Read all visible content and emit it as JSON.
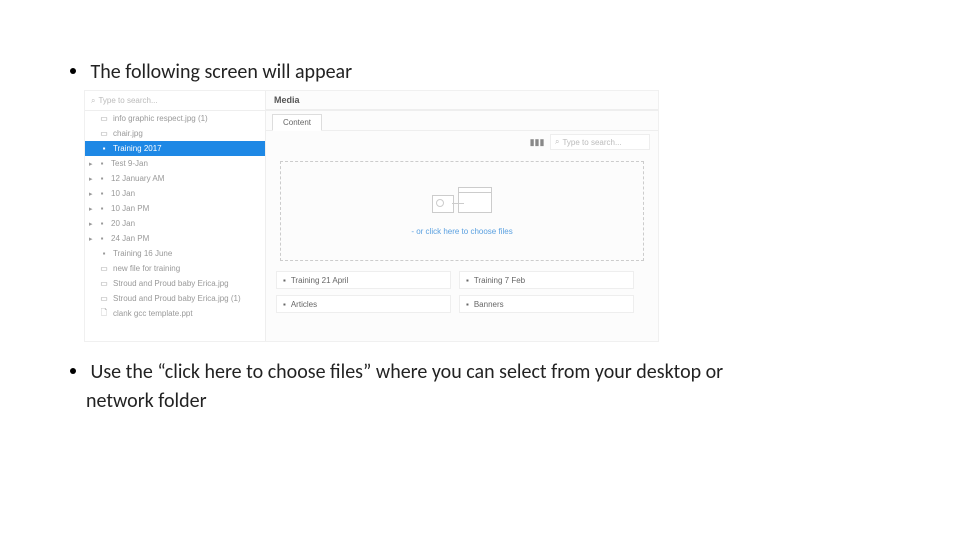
{
  "bullets": {
    "b1": "The following screen will appear",
    "b2a": "Use the “click here to choose files” where you can select from your desktop or",
    "b2b": "network folder"
  },
  "sidebar": {
    "search_placeholder": "Type to search...",
    "items": [
      {
        "icon": "image",
        "label": "info graphic respect.jpg (1)",
        "expandable": false
      },
      {
        "icon": "image",
        "label": "chair.jpg",
        "expandable": false
      },
      {
        "icon": "folder",
        "label": "Training 2017",
        "expandable": false,
        "selected": true
      },
      {
        "icon": "folder",
        "label": "Test 9-Jan",
        "expandable": true
      },
      {
        "icon": "folder",
        "label": "12 January AM",
        "expandable": true
      },
      {
        "icon": "folder",
        "label": "10 Jan",
        "expandable": true
      },
      {
        "icon": "folder",
        "label": "10 Jan PM",
        "expandable": true
      },
      {
        "icon": "folder",
        "label": "20 Jan",
        "expandable": true
      },
      {
        "icon": "folder",
        "label": "24 Jan PM",
        "expandable": true
      },
      {
        "icon": "folder",
        "label": "Training 16 June",
        "expandable": false
      },
      {
        "icon": "file",
        "label": "new file for training",
        "expandable": false
      },
      {
        "icon": "image",
        "label": "Stroud and Proud baby Erica.jpg",
        "expandable": false
      },
      {
        "icon": "image",
        "label": "Stroud and Proud baby Erica.jpg (1)",
        "expandable": false
      },
      {
        "icon": "doc",
        "label": "clank gcc template.ppt",
        "expandable": false
      }
    ]
  },
  "main": {
    "title": "Media",
    "tab_content": "Content",
    "search_placeholder": "Type to search...",
    "drop_link": "- or click here to choose files",
    "grid": [
      {
        "label": "Training 21 April"
      },
      {
        "label": "Training 7 Feb"
      },
      {
        "label": "Articles"
      },
      {
        "label": "Banners"
      }
    ]
  }
}
